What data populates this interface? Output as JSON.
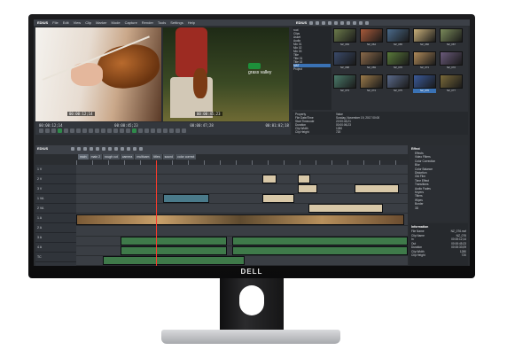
{
  "app": {
    "brand": "EDIUS",
    "menu": [
      "File",
      "Edit",
      "View",
      "Clip",
      "Marker",
      "Mode",
      "Capture",
      "Render",
      "Tools",
      "Settings",
      "Help"
    ]
  },
  "bin": {
    "title": "EDIUS",
    "folders": [
      "root",
      "Clips",
      "Asset",
      "Audio",
      "Mix 01",
      "Mix 02",
      "Mix 03",
      "Title",
      "Title 01",
      "Title 02",
      "MAT",
      "Project"
    ],
    "selected_folder": "MAT",
    "clips": [
      {
        "label": "NZ_063"
      },
      {
        "label": "NZ_064"
      },
      {
        "label": "NZ_065"
      },
      {
        "label": "NZ_066"
      },
      {
        "label": "NZ_067"
      },
      {
        "label": "NZ_068"
      },
      {
        "label": "NZ_069"
      },
      {
        "label": "NZ_070"
      },
      {
        "label": "NZ_071"
      },
      {
        "label": "NZ_072"
      },
      {
        "label": "NZ_073"
      },
      {
        "label": "NZ_074"
      },
      {
        "label": "NZ_075"
      },
      {
        "label": "NZ_076"
      },
      {
        "label": "NZ_077"
      }
    ],
    "selected_clip": 13,
    "properties": [
      [
        "Property",
        "Value"
      ],
      [
        "File Date/Time",
        "Sunday, November 19, 2017 00:00"
      ],
      [
        "Start Timecode",
        "22:00:43;21"
      ],
      [
        "Duration",
        "00:00:06;23"
      ],
      [
        "Clip Width",
        "1280"
      ],
      [
        "Clip Height",
        "720"
      ]
    ]
  },
  "player_left": {
    "timecode": "00:00:12;14"
  },
  "player_right": {
    "overlay_title": "grass valley",
    "timecode": "00:00:45;23"
  },
  "transport": {
    "tc_left_in": "00:00:12;14",
    "tc_left_out": "00:00:45;23",
    "tc_right_in": "00:00:47;28",
    "tc_right_out": "00:01:02;18"
  },
  "timeline": {
    "title": "EDIUS",
    "tabs": [
      "main",
      "main 2",
      "rough cut",
      "camera",
      "multicam",
      "titles",
      "sound",
      "color correct"
    ],
    "active_tab": 0,
    "tracks": [
      "1 V",
      "2 V",
      "3 V",
      "1 VA",
      "2 VA",
      "1 A",
      "2 A",
      "3 A",
      "4 A",
      "TC"
    ],
    "status": [
      "Pause",
      "Insert Mode",
      "Sync",
      "Disk: 63% is being used (C:)"
    ]
  },
  "effects": {
    "title": "Effect",
    "items": [
      "Effects",
      "Video Filters",
      "Color Correction",
      "Blur",
      "Color Balance",
      "Distortion",
      "Old Film",
      "Time Effect",
      "Transitions",
      "Audio Fades",
      "Keyers",
      "Titlers",
      "Wipes",
      "Border",
      "3D"
    ]
  },
  "info": {
    "title": "Information",
    "rows": [
      [
        "File Name",
        "NZ_076.mxf"
      ],
      [
        "Clip Name",
        "NZ_076"
      ],
      [
        "In",
        "00:00:12;14"
      ],
      [
        "Out",
        "00:00:45;23"
      ],
      [
        "Duration",
        "00:00:33;09"
      ],
      [
        "Clip Width",
        "1280"
      ],
      [
        "Clip Height",
        "720"
      ]
    ]
  },
  "hardware": {
    "logo": "DELL"
  },
  "colors": {
    "accent": "#3a72b5",
    "playhead": "#ff3a2a"
  }
}
